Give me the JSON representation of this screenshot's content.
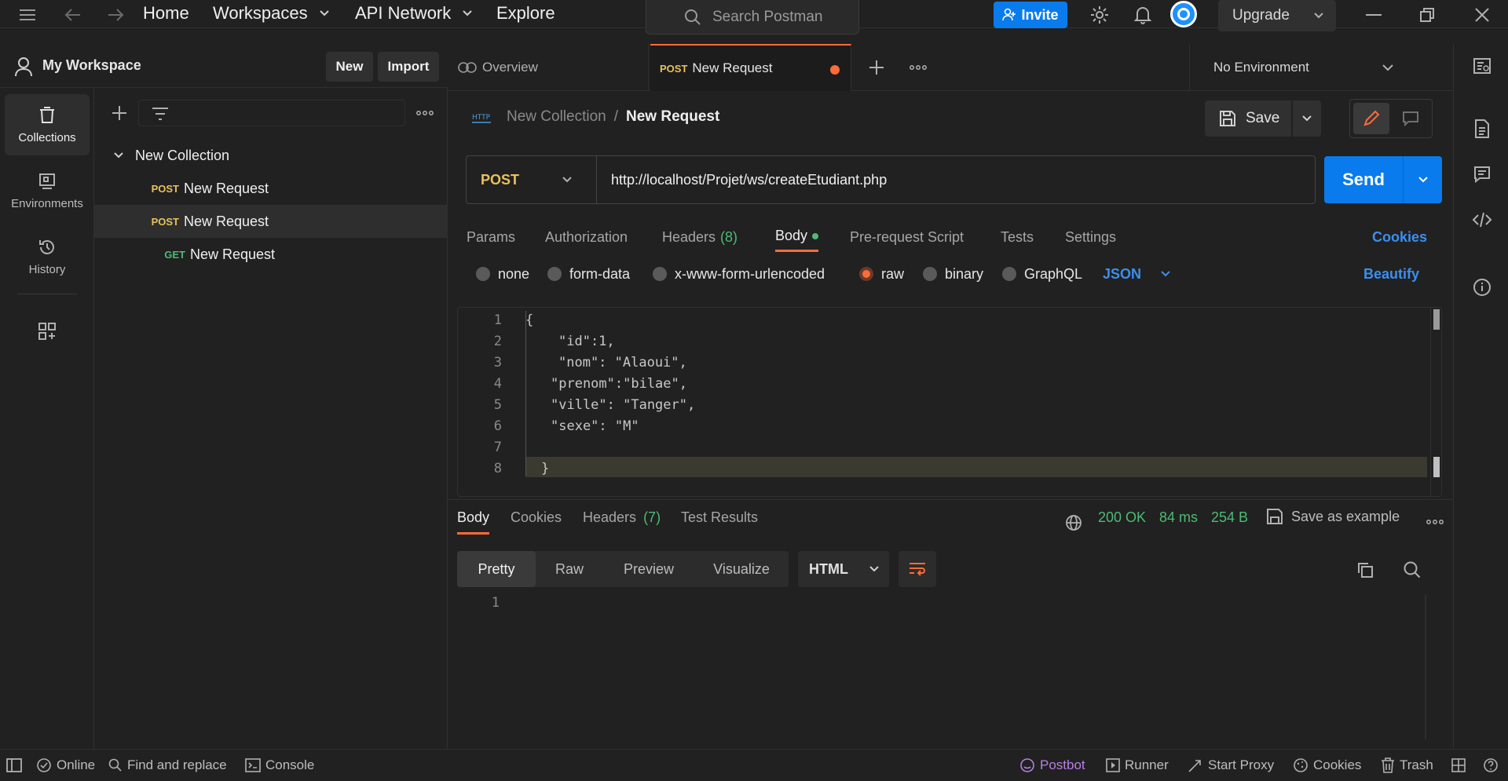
{
  "topbar": {
    "nav": [
      "Home",
      "Workspaces",
      "API Network",
      "Explore"
    ],
    "search_placeholder": "Search Postman",
    "invite_label": "Invite",
    "upgrade_label": "Upgrade"
  },
  "workspace": {
    "name": "My Workspace",
    "new_label": "New",
    "import_label": "Import"
  },
  "sidebar": {
    "items": [
      {
        "label": "Collections",
        "icon": "collections-icon",
        "active": true
      },
      {
        "label": "Environments",
        "icon": "environments-icon"
      },
      {
        "label": "History",
        "icon": "history-icon"
      }
    ]
  },
  "tree": {
    "collection": "New Collection",
    "requests": [
      {
        "method": "POST",
        "name": "New Request"
      },
      {
        "method": "POST",
        "name": "New Request",
        "selected": true
      },
      {
        "method": "GET",
        "name": "New Request"
      }
    ]
  },
  "tabs": {
    "overview": "Overview",
    "active_method": "POST",
    "active_name": "New Request",
    "environment": "No Environment"
  },
  "request": {
    "breadcrumb_collection": "New Collection",
    "breadcrumb_sep": "/",
    "breadcrumb_request": "New Request",
    "save_label": "Save",
    "method": "POST",
    "url": "http://localhost/Projet/ws/createEtudiant.php",
    "send_label": "Send",
    "tabs": [
      "Params",
      "Authorization",
      "Headers",
      "Body",
      "Pre-request Script",
      "Tests",
      "Settings"
    ],
    "headers_count": "(8)",
    "cookies_label": "Cookies",
    "body_types": [
      "none",
      "form-data",
      "x-www-form-urlencoded",
      "raw",
      "binary",
      "GraphQL"
    ],
    "body_format": "JSON",
    "beautify_label": "Beautify",
    "line_numbers": [
      "1",
      "2",
      "3",
      "4",
      "5",
      "6",
      "7",
      "8"
    ],
    "body_lines": [
      "{",
      "\"id\":1,",
      "\"nom\": \"Alaoui\",",
      "\"prenom\":\"bilae\",",
      "\"ville\": \"Tanger\",",
      "\"sexe\": \"M\"",
      "",
      "}"
    ]
  },
  "response": {
    "tabs": [
      "Body",
      "Cookies",
      "Headers",
      "Test Results"
    ],
    "headers_count": "(7)",
    "status": "200 OK",
    "time": "84 ms",
    "size": "254 B",
    "save_example_label": "Save as example",
    "views": [
      "Pretty",
      "Raw",
      "Preview",
      "Visualize"
    ],
    "format": "HTML",
    "line_number": "1"
  },
  "statusbar": {
    "online": "Online",
    "find_replace": "Find and replace",
    "console": "Console",
    "postbot": "Postbot",
    "runner": "Runner",
    "start_proxy": "Start Proxy",
    "cookies": "Cookies",
    "trash": "Trash"
  },
  "colors": {
    "accent_blue": "#097bed",
    "accent_orange": "#ff6c37",
    "status_green": "#4dbb75",
    "post_yellow": "#e8c25a"
  }
}
